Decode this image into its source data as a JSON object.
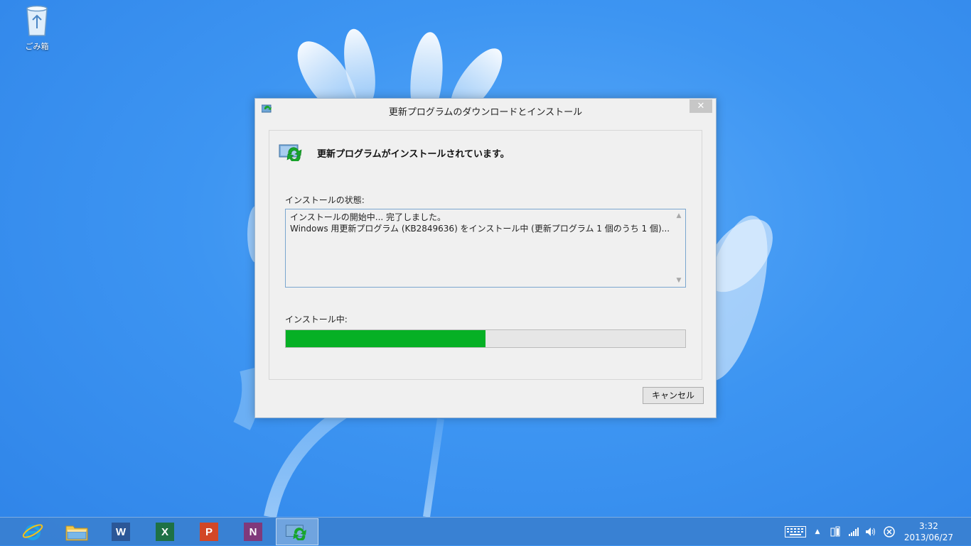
{
  "desktop": {
    "recycle_bin_label": "ごみ箱"
  },
  "dialog": {
    "title": "更新プログラムのダウンロードとインストール",
    "close_symbol": "✕",
    "heading": "更新プログラムがインストールされています。",
    "status_label": "インストールの状態:",
    "log_lines": [
      "インストールの開始中... 完了しました。",
      "Windows 用更新プログラム (KB2849636) をインストール中 (更新プログラム 1 個のうち 1 個)..."
    ],
    "progress_label": "インストール中:",
    "progress_fraction": 0.5,
    "cancel_label": "キャンセル"
  },
  "taskbar": {
    "apps": [
      {
        "name": "internet-explorer",
        "icon": "ie-icon"
      },
      {
        "name": "file-explorer",
        "icon": "folder-icon"
      },
      {
        "name": "word",
        "icon": "word-icon",
        "letter": "W",
        "color": "#2b5797"
      },
      {
        "name": "excel",
        "icon": "excel-icon",
        "letter": "X",
        "color": "#1e7145"
      },
      {
        "name": "powerpoint",
        "icon": "powerpoint-icon",
        "letter": "P",
        "color": "#d24726"
      },
      {
        "name": "onenote",
        "icon": "onenote-icon",
        "letter": "N",
        "color": "#80397b"
      },
      {
        "name": "windows-update",
        "icon": "windows-update-icon",
        "active": true
      }
    ],
    "clock": {
      "time": "3:32",
      "date": "2013/06/27"
    }
  },
  "colors": {
    "progress": "#06b025",
    "desktop": "#3d95f2"
  }
}
